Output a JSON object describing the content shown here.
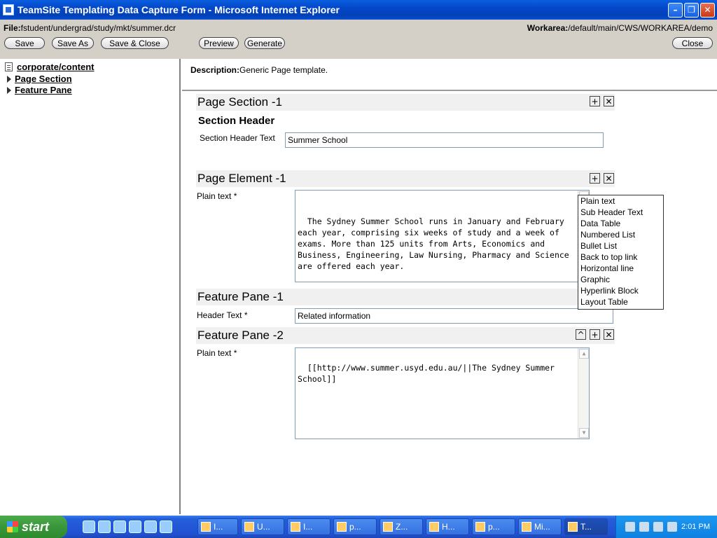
{
  "window": {
    "title": "TeamSite Templating Data Capture Form - Microsoft Internet Explorer",
    "min": "–",
    "max": "❐",
    "close": "✕"
  },
  "header": {
    "file_label": "File:",
    "file_path": "fstudent/undergrad/study/mkt/summer.dcr",
    "workarea_label": "Workarea:",
    "workarea_path": "/default/main/CWS/WORKAREA/demo",
    "buttons": {
      "save": "Save",
      "save_as": "Save As",
      "save_close": "Save & Close",
      "preview": "Preview",
      "generate": "Generate",
      "close": "Close"
    }
  },
  "tree": {
    "root": "corporate/content",
    "items": [
      "Page Section",
      "Feature Pane"
    ]
  },
  "description": {
    "label": "Description:",
    "text": "Generic Page template."
  },
  "page_section": {
    "title": "Page Section -1",
    "subheader": "Section Header",
    "field_label": "Section Header Text",
    "field_value": "Summer School"
  },
  "page_element": {
    "title": "Page Element -1",
    "field_label": "Plain text *",
    "field_value": "The Sydney Summer School runs in January and February each year, comprising six weeks of study and a week of exams. More than 125 units from Arts, Economics and Business, Engineering, Law Nursing, Pharmacy and Science are offered each year."
  },
  "dropdown": {
    "options": [
      "Plain text",
      "Sub Header Text",
      "Data Table",
      "Numbered List",
      "Bullet List",
      "Back to top link",
      "Horizontal line",
      "Graphic",
      "Hyperlink Block",
      "Layout Table"
    ]
  },
  "feature_pane_1": {
    "title": "Feature Pane -1",
    "field_label": "Header Text *",
    "field_value": "Related information"
  },
  "feature_pane_2": {
    "title": "Feature Pane -2",
    "field_label": "Plain text *",
    "field_value": "[[http://www.summer.usyd.edu.au/||The Sydney Summer School]]"
  },
  "controls": {
    "add": "+",
    "remove": "✕",
    "up": "^"
  },
  "taskbar": {
    "start": "start",
    "tasks": [
      "I...",
      "U...",
      "I...",
      "p...",
      "Z...",
      "H...",
      "p...",
      "Mi...",
      "T..."
    ],
    "clock": "2:01 PM"
  }
}
